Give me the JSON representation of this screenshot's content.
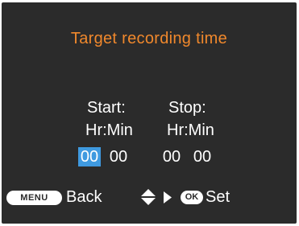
{
  "screen": {
    "title": "Target recording time",
    "start_label": "Start:",
    "stop_label": "Stop:",
    "start_format": "Hr:Min",
    "stop_format": "Hr:Min",
    "start_hour": "00",
    "start_min": "00",
    "stop_hour": "00",
    "stop_min": "00",
    "selected_field": "start_hour"
  },
  "footer": {
    "menu_button": "MENU",
    "back_label": "Back",
    "ok_button": "OK",
    "set_label": "Set"
  },
  "icons": {
    "up_down": "up-down-arrow-icon",
    "right": "right-arrow-icon"
  },
  "colors": {
    "background": "#2b2b2b",
    "title": "#f0882c",
    "text": "#ffffff",
    "selection": "#3f9ae0"
  }
}
